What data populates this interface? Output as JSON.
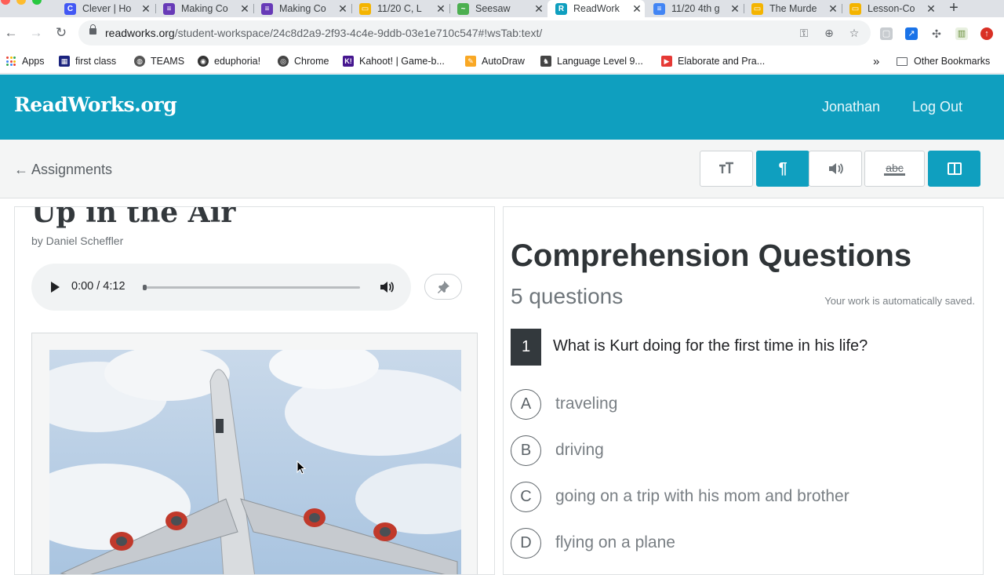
{
  "browser": {
    "tabs": [
      {
        "title": "Clever | Ho",
        "icon": "C",
        "color": "#4258f4"
      },
      {
        "title": "Making Co",
        "icon": "≡",
        "color": "#673ab7"
      },
      {
        "title": "Making Co",
        "icon": "≡",
        "color": "#673ab7"
      },
      {
        "title": "11/20 C, L",
        "icon": "▭",
        "color": "#f4b400"
      },
      {
        "title": "Seesaw",
        "icon": "~",
        "color": "#4caf50"
      },
      {
        "title": "ReadWork",
        "icon": "R",
        "color": "#0f9fbf"
      },
      {
        "title": "11/20 4th g",
        "icon": "≡",
        "color": "#4285f4"
      },
      {
        "title": "The Murde",
        "icon": "▭",
        "color": "#f4b400"
      },
      {
        "title": "Lesson-Co",
        "icon": "▭",
        "color": "#f4b400"
      }
    ],
    "new_tab": "+",
    "url_host": "readworks.org",
    "url_path": "/student-workspace/24c8d2a9-2f93-4c4e-9ddb-03e1e710c547#!wsTab:text/",
    "bookmarks": [
      {
        "label": "Apps"
      },
      {
        "label": "first class",
        "icon": "▦",
        "color": "#1a237e"
      },
      {
        "label": "TEAMS",
        "icon": "◍",
        "color": "#555"
      },
      {
        "label": "eduphoria!",
        "icon": "◉",
        "color": "#333"
      },
      {
        "label": "Chrome",
        "icon": "◎",
        "color": "#444"
      },
      {
        "label": "Kahoot! | Game-b...",
        "icon": "K!",
        "color": "#46178f"
      },
      {
        "label": "AutoDraw",
        "icon": "✎",
        "color": "#f9a825"
      },
      {
        "label": "Language Level 9...",
        "icon": "♞",
        "color": "#444"
      },
      {
        "label": "Elaborate and Pra...",
        "icon": "▶",
        "color": "#e53935"
      }
    ],
    "bookmarks_overflow": "»",
    "other_bookmarks": "Other Bookmarks"
  },
  "header": {
    "logo": "ReadWorks.org",
    "user": "Jonathan",
    "logout": "Log Out"
  },
  "subbar": {
    "back": "← Assignments",
    "tools": [
      {
        "name": "text-size-tool",
        "icon": "text-size-icon",
        "active": false
      },
      {
        "name": "paragraph-tool",
        "icon": "paragraph-icon",
        "active": true
      },
      {
        "name": "audio-tool",
        "icon": "speaker-icon",
        "active": false
      },
      {
        "name": "strikethrough-tool",
        "icon": "abc-strike-icon",
        "label": "abc",
        "active": false
      },
      {
        "name": "split-view-tool",
        "icon": "split-view-icon",
        "active": true
      }
    ]
  },
  "article": {
    "title": "Up in the Air",
    "byline": "by Daniel Scheffler",
    "audio": {
      "time": "0:00 / 4:12",
      "progress": 0.0
    }
  },
  "questions": {
    "title": "Comprehension Questions",
    "count": "5 questions",
    "saved": "Your work is automatically saved.",
    "current": {
      "number": "1",
      "text": "What is Kurt doing for the first time in his life?",
      "choices": [
        {
          "letter": "A",
          "text": "traveling"
        },
        {
          "letter": "B",
          "text": "driving"
        },
        {
          "letter": "C",
          "text": "going on a trip with his mom and brother"
        },
        {
          "letter": "D",
          "text": "flying on a plane"
        }
      ]
    }
  },
  "colors": {
    "brand": "#0f9fbf",
    "dark": "#33393d"
  }
}
